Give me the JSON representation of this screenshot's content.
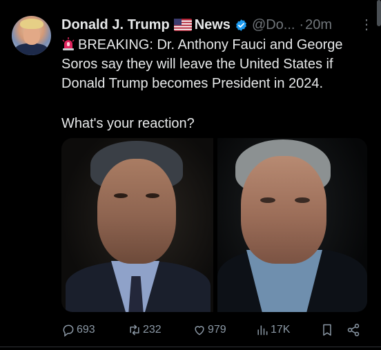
{
  "tweet": {
    "author_name": "Donald J. Trump",
    "author_suffix": "News",
    "handle": "@Do...",
    "separator": "·",
    "time": "20m",
    "more_label": "⋮",
    "breaking_text": "BREAKING: Dr. Anthony Fauci and George Soros say they will leave the United States if Donald Trump becomes President in 2024.",
    "question": "What's your reaction?"
  },
  "actions": {
    "replies": "693",
    "retweets": "232",
    "likes": "979",
    "views": "17K"
  },
  "icons": {
    "flag": "us-flag-icon",
    "verified": "verified-badge-icon",
    "siren": "siren-icon",
    "reply": "reply-icon",
    "retweet": "retweet-icon",
    "like": "heart-icon",
    "views": "views-chart-icon",
    "bookmark": "bookmark-icon",
    "share": "share-icon"
  },
  "colors": {
    "background": "#000000",
    "text": "#e7e9ea",
    "muted": "#71767b",
    "verified": "#1d9bf0"
  }
}
